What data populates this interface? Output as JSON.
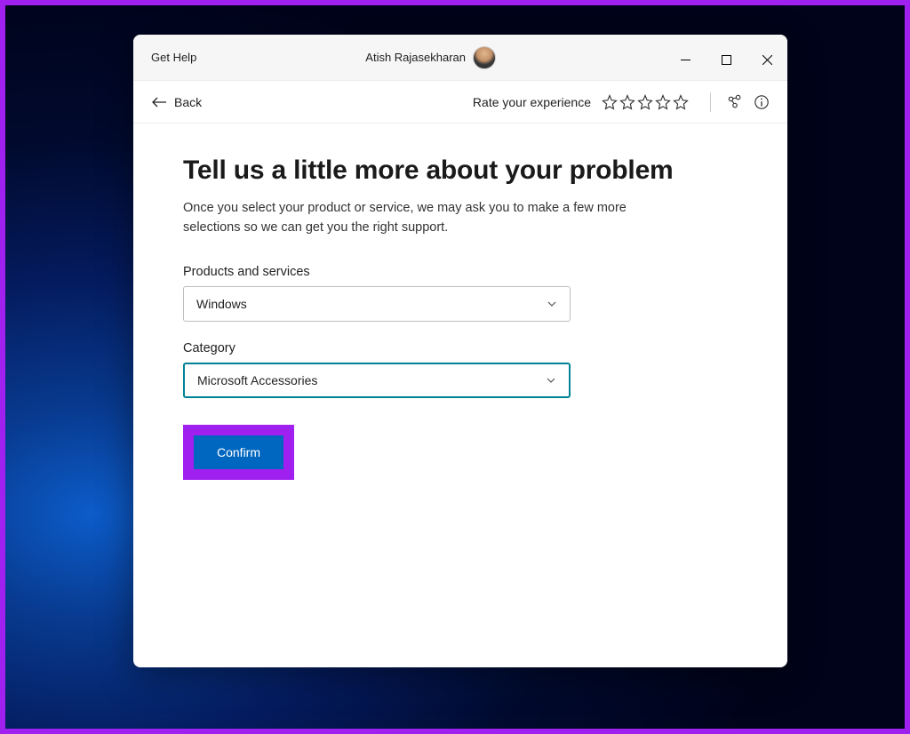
{
  "window": {
    "title": "Get Help",
    "user_name": "Atish Rajasekharan"
  },
  "toolbar": {
    "back_label": "Back",
    "rate_label": "Rate your experience"
  },
  "main": {
    "heading": "Tell us a little more about your problem",
    "subtext": "Once you select your product or service, we may ask you to make a few more selections so we can get you the right support.",
    "products_label": "Products and services",
    "products_value": "Windows",
    "category_label": "Category",
    "category_value": "Microsoft Accessories",
    "confirm_label": "Confirm"
  }
}
